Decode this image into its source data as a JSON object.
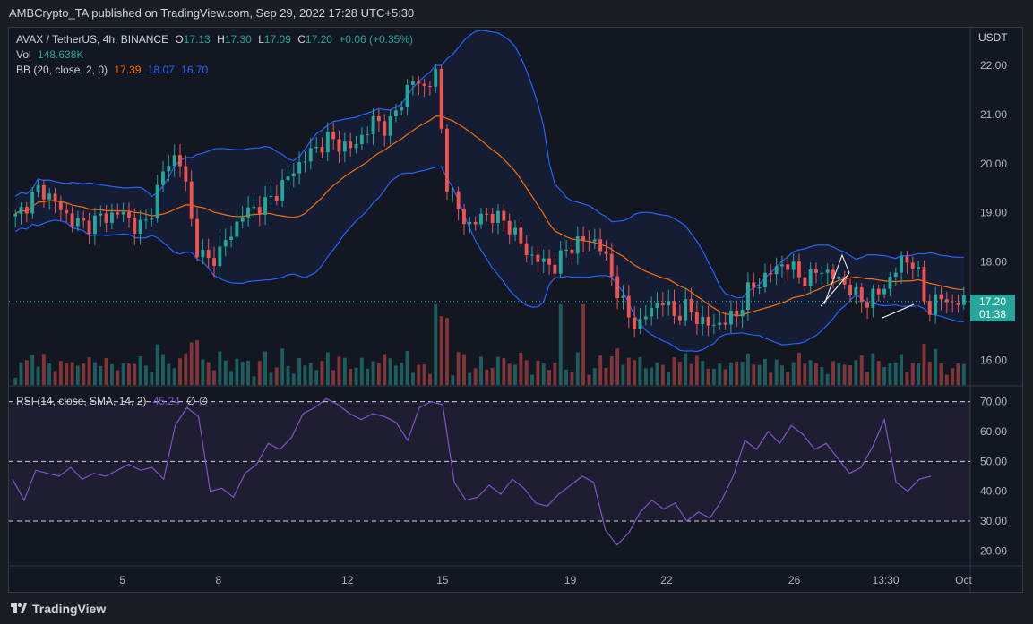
{
  "publisher": "AMBCrypto_TA published on TradingView.com, Sep 29, 2022 17:28 UTC+5:30",
  "header": {
    "symbol": "AVAX / TetherUS, 4h, BINANCE",
    "o_label": "O",
    "o": "17.13",
    "h_label": "H",
    "h": "17.30",
    "l_label": "L",
    "l": "17.09",
    "c_label": "C",
    "c": "17.20",
    "change": "+0.06 (+0.35%)",
    "vol_label": "Vol",
    "vol": "148.638K",
    "bb_label": "BB (20, close, 2, 0)",
    "bb_mid": "17.39",
    "bb_up": "18.07",
    "bb_low": "16.70"
  },
  "currency": "USDT",
  "price_tag": {
    "price": "17.20",
    "countdown": "01:38"
  },
  "rsi_label": "RSI (14, close, SMA, 14, 2)",
  "rsi_value": "45.24",
  "rsi_na": "∅ ∅",
  "brand": "TradingView",
  "colors": {
    "up": "#26a69a",
    "down": "#ef5350",
    "bb": "#2962ff",
    "basis": "#ff6d00",
    "rsi": "#7e57c2",
    "bg": "#131722"
  },
  "chart_data": [
    {
      "type": "candlestick",
      "title": "AVAX / TetherUS, 4h, BINANCE",
      "ylabel": "USDT",
      "ylim": [
        15.5,
        22.6
      ],
      "y_ticks": [
        "22.00",
        "21.00",
        "20.00",
        "19.00",
        "18.00",
        "17.00",
        "16.00"
      ],
      "x_ticks": [
        "5",
        "8",
        "12",
        "15",
        "19",
        "22",
        "26",
        "13:30",
        "Oct"
      ],
      "close_path": [
        18.9,
        19.2,
        19.5,
        19.3,
        19.0,
        18.8,
        18.75,
        18.9,
        18.95,
        19.0,
        18.7,
        18.8,
        19.6,
        20.2,
        19.9,
        18.3,
        18.0,
        18.2,
        18.6,
        19.0,
        19.1,
        19.2,
        19.5,
        19.8,
        20.1,
        20.3,
        20.5,
        20.4,
        20.3,
        20.6,
        20.9,
        20.7,
        21.2,
        21.7,
        21.55,
        21.8,
        19.5,
        19.0,
        18.7,
        19.0,
        18.9,
        18.8,
        18.4,
        18.1,
        18.0,
        17.9,
        18.3,
        18.4,
        18.5,
        18.2,
        17.5,
        16.9,
        16.7,
        17.1,
        17.2,
        16.9,
        17.1,
        16.8,
        16.7,
        16.8,
        16.9,
        17.4,
        17.6,
        17.8,
        18.0,
        17.8,
        17.6,
        17.9,
        17.7,
        17.6,
        17.3,
        17.2,
        17.4,
        17.7,
        18.1,
        17.9,
        17.0,
        17.3,
        17.15,
        17.2
      ],
      "volume": "148.638K",
      "bb": {
        "length": 20,
        "mult": 2,
        "basis": 17.39,
        "upper": 18.07,
        "lower": 16.7
      }
    },
    {
      "type": "line",
      "title": "RSI (14, close, SMA, 14, 2)",
      "ylim": [
        15,
        75
      ],
      "y_ticks": [
        "70.00",
        "60.00",
        "50.00",
        "40.00",
        "30.00",
        "20.00"
      ],
      "bands": [
        70,
        50,
        30
      ],
      "value": 45.24,
      "series": [
        {
          "values": [
            44,
            37,
            47,
            46,
            45,
            48,
            44,
            46,
            45,
            47,
            49,
            47,
            48,
            44,
            62,
            68,
            65,
            40,
            41,
            38,
            46,
            49,
            56,
            54,
            58,
            66,
            68,
            71,
            69,
            66,
            64,
            66,
            65,
            63,
            57,
            68,
            70,
            69,
            43,
            37,
            38,
            42,
            39,
            44,
            41,
            36,
            35,
            39,
            42,
            45,
            43,
            27,
            22,
            26,
            33,
            37,
            34,
            36,
            30,
            33,
            31,
            37,
            45,
            57,
            54,
            60,
            56,
            62,
            59,
            54,
            56,
            51,
            46,
            48,
            55,
            64,
            43,
            40,
            44,
            45
          ]
        }
      ]
    }
  ]
}
